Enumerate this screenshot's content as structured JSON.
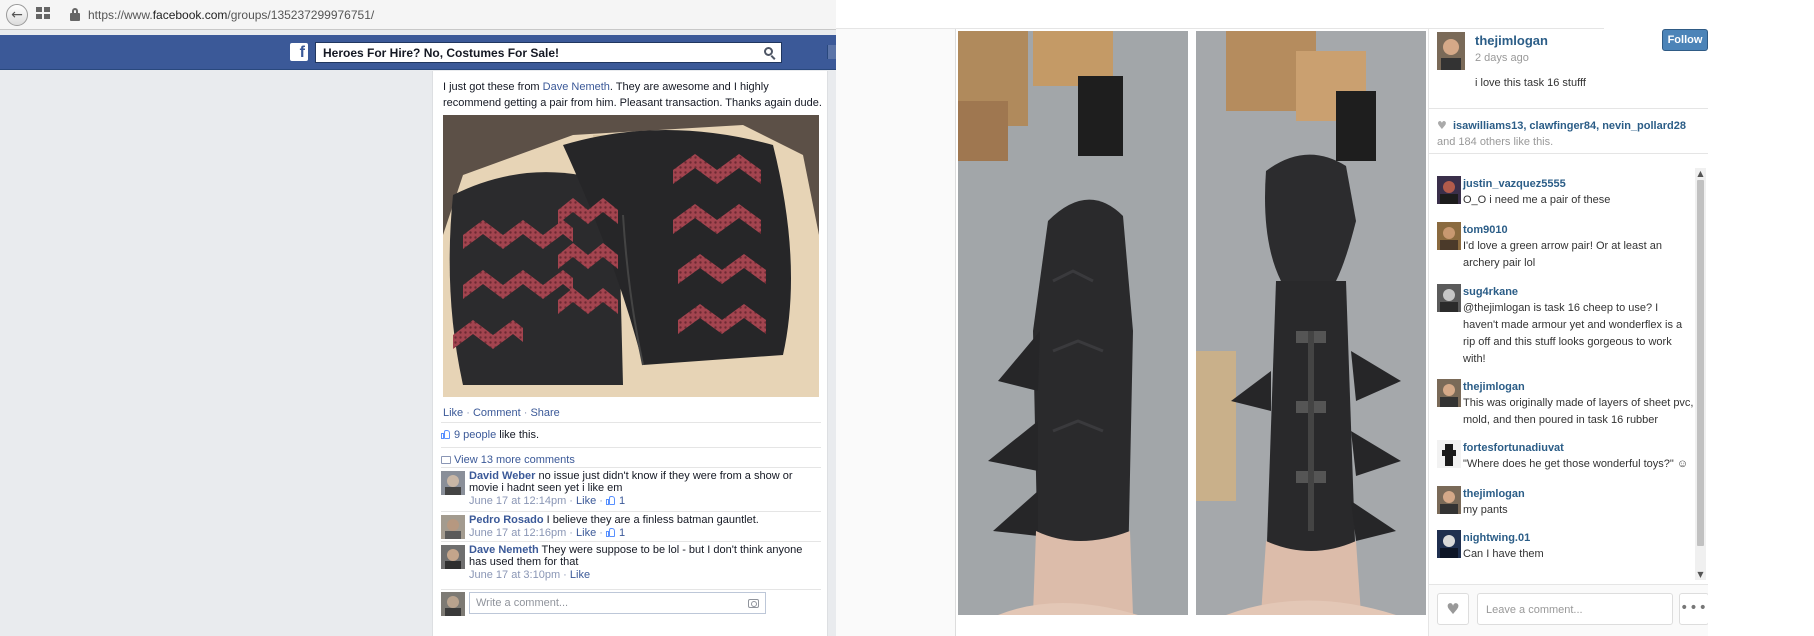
{
  "browser": {
    "url_prefix": "https://www.",
    "url_domain": "facebook.com",
    "url_path": "/groups/135237299976751/"
  },
  "facebook": {
    "search_value": "Heroes For Hire? No, Costumes For Sale!",
    "brand_color": "#3b5998",
    "post": {
      "text_before": "I just got these from ",
      "author_link": "Dave Nemeth",
      "text_after": ". They are awesome and I highly recommend getting a pair from him. Pleasant transaction. Thanks again dude.",
      "actions": {
        "like": "Like",
        "comment": "Comment",
        "share": "Share",
        "separator": " · "
      },
      "likes_link": "9 people",
      "likes_suffix": " like this.",
      "view_more": "View 13 more comments",
      "comments": [
        {
          "name": "David Weber",
          "text": " no issue just didn't know if they were from a show or movie i hadnt seen yet i like em",
          "time": "June 17 at 12:14pm",
          "like": "Like",
          "likes": "1"
        },
        {
          "name": "Pedro Rosado",
          "text": " I believe they are a finless batman gauntlet.",
          "time": "June 17 at 12:16pm",
          "like": "Like",
          "likes": "1"
        },
        {
          "name": "Dave Nemeth",
          "text": " They were suppose to be lol - but I don't think anyone has used them for that",
          "time": "June 17 at 3:10pm",
          "like": "Like",
          "likes": ""
        }
      ],
      "write_placeholder": "Write a comment..."
    }
  },
  "instagram": {
    "owner": {
      "name": "thejimlogan",
      "time": "2 days ago",
      "caption": "i love this task 16 stufff"
    },
    "follow_label": "Follow",
    "likes_names": "isawilliams13, clawfinger84, nevin_pollard28",
    "likes_suffix": " and 184 others like this.",
    "comments": [
      {
        "name": "justin_vazquez5555",
        "text": "O_O i need me a pair of these"
      },
      {
        "name": "tom9010",
        "text": "I'd love a green arrow pair! Or at least an archery pair lol"
      },
      {
        "name": "sug4rkane",
        "text": "@thejimlogan is task 16 cheep to use? I haven't made armour yet and wonderflex is a rip off and this stuff looks gorgeous to work with!"
      },
      {
        "name": "thejimlogan",
        "text": "This was originally made of layers of sheet pvc, mold, and then poured in task 16 rubber"
      },
      {
        "name": "fortesfortunadiuvat",
        "text": "\"Where does he get those wonderful toys?\" ☺"
      },
      {
        "name": "thejimlogan",
        "text": "my pants"
      },
      {
        "name": "nightwing.01",
        "text": "Can I have them"
      }
    ],
    "comment_placeholder": "Leave a comment...",
    "more_label": "•••",
    "link_color": "#2b5d87"
  }
}
